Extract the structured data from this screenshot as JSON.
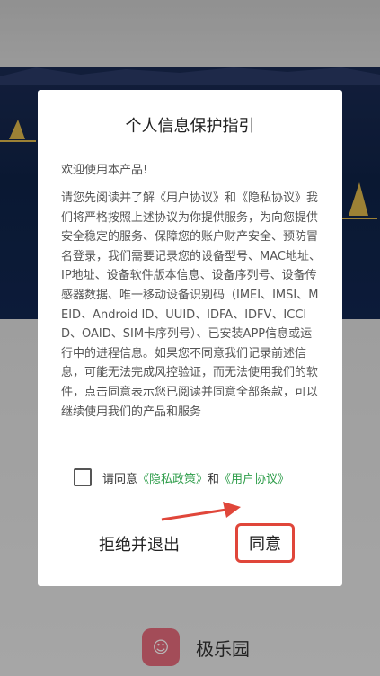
{
  "dialog": {
    "title": "个人信息保护指引",
    "welcome": "欢迎使用本产品!",
    "body": "请您先阅读并了解《用户协议》和《隐私协议》我们将严格按照上述协议为你提供服务，为向您提供安全稳定的服务、保障您的账户财产安全、预防冒名登录，我们需要记录您的设备型号、MAC地址、IP地址、设备软件版本信息、设备序列号、设备传感器数据、唯一移动设备识别码（IMEI、IMSI、MEID、Android ID、UUID、IDFA、IDFV、ICCID、OAID、SIM卡序列号）、已安装APP信息或运行中的进程信息。如果您不同意我们记录前述信息，可能无法完成风控验证，而无法使用我们的软件，点击同意表示您已阅读并同意全部条款，可以继续使用我们的产品和服务",
    "consent": {
      "prefix": "请同意",
      "privacy_link": "《隐私政策》",
      "and": "和",
      "user_link": "《用户协议》"
    },
    "reject_label": "拒绝并退出",
    "agree_label": "同意"
  },
  "app": {
    "name": "极乐园"
  },
  "colors": {
    "link": "#2e9d4a",
    "highlight": "#e0463a",
    "scene": "#112650"
  }
}
